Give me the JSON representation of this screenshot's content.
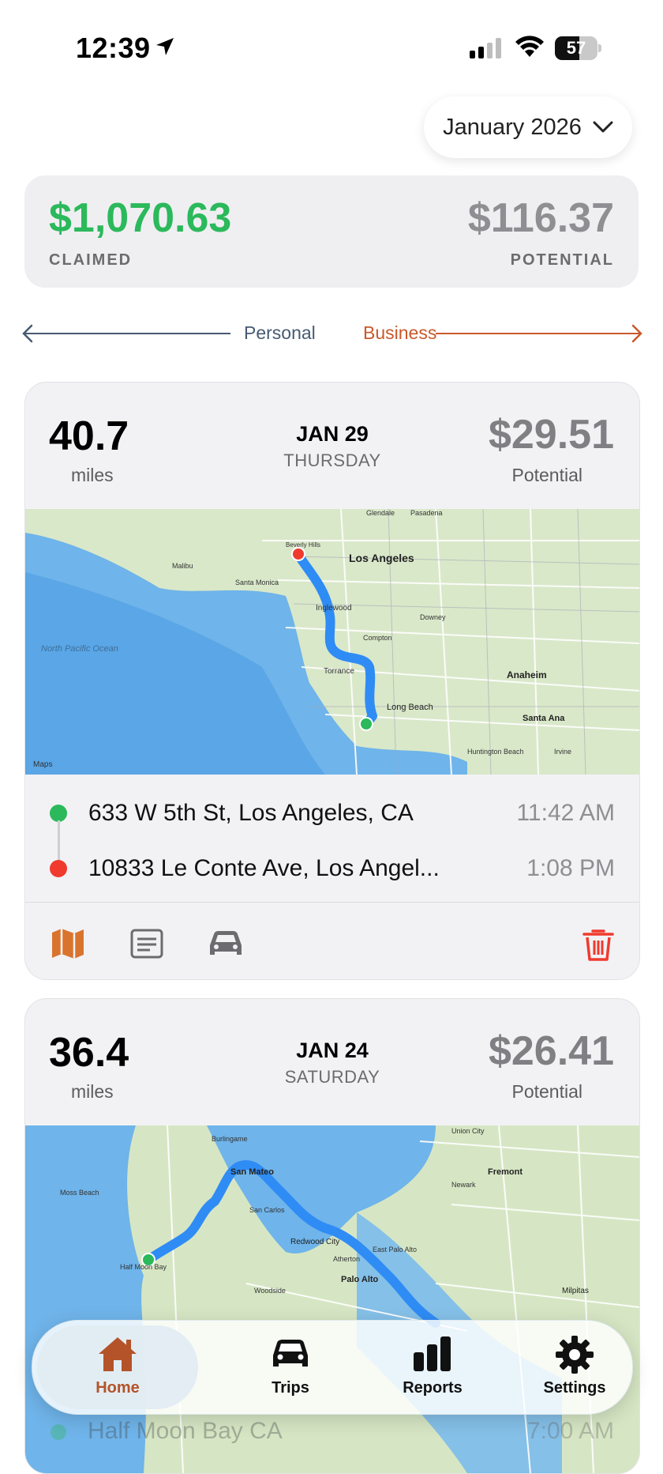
{
  "status_bar": {
    "time": "12:39",
    "battery": "57",
    "battery_level": 0.57
  },
  "month_selector": {
    "label": "January 2026"
  },
  "summary": {
    "claimed_amount": "$1,070.63",
    "claimed_label": "CLAIMED",
    "potential_amount": "$116.37",
    "potential_label": "POTENTIAL"
  },
  "swipe_hint": {
    "left_label": "Personal",
    "right_label": "Business"
  },
  "trips": [
    {
      "miles": "40.7",
      "miles_label": "miles",
      "date": "JAN 29",
      "weekday": "THURSDAY",
      "amount": "$29.51",
      "amount_label": "Potential",
      "map_labels": {
        "city": "Los Angeles",
        "ocean": "North Pacific Ocean",
        "places": [
          "Santa Monica",
          "Torrance",
          "Long Beach",
          "Anaheim",
          "Santa Ana",
          "Downey",
          "Inglewood",
          "Pasadena",
          "Huntington Beach",
          "Irvine",
          "Malibu",
          "Glendale",
          "Beverly Hills",
          "Compton"
        ],
        "attribution": "Maps"
      },
      "start": {
        "address": "633 W 5th St, Los Angeles, CA",
        "time": "11:42 AM"
      },
      "end": {
        "address": "10833 Le Conte Ave, Los Angel...",
        "time": "1:08 PM"
      }
    },
    {
      "miles": "36.4",
      "miles_label": "miles",
      "date": "JAN 24",
      "weekday": "SATURDAY",
      "amount": "$26.41",
      "amount_label": "Potential",
      "map_labels": {
        "places": [
          "Fremont",
          "Palo Alto",
          "Redwood City",
          "San Mateo",
          "Moss Beach",
          "Half Moon Bay",
          "Milpitas",
          "Burlingame",
          "Union City",
          "Newark",
          "Woodside",
          "Atherton",
          "East Palo Alto",
          "San Carlos"
        ]
      },
      "start": {
        "address": "Half Moon Bay CA",
        "time": "7:00 AM"
      }
    }
  ],
  "tab_bar": {
    "items": [
      {
        "label": "Home",
        "icon": "home-icon",
        "active": true
      },
      {
        "label": "Trips",
        "icon": "car-icon",
        "active": false
      },
      {
        "label": "Reports",
        "icon": "bar-chart-icon",
        "active": false
      },
      {
        "label": "Settings",
        "icon": "gear-icon",
        "active": false
      }
    ]
  },
  "colors": {
    "claimed": "#2bb95b",
    "business": "#c9592b",
    "personal": "#475a72",
    "route": "#2f8cf5",
    "delete": "#f03a2e",
    "accent_icon": "#d9742f"
  }
}
